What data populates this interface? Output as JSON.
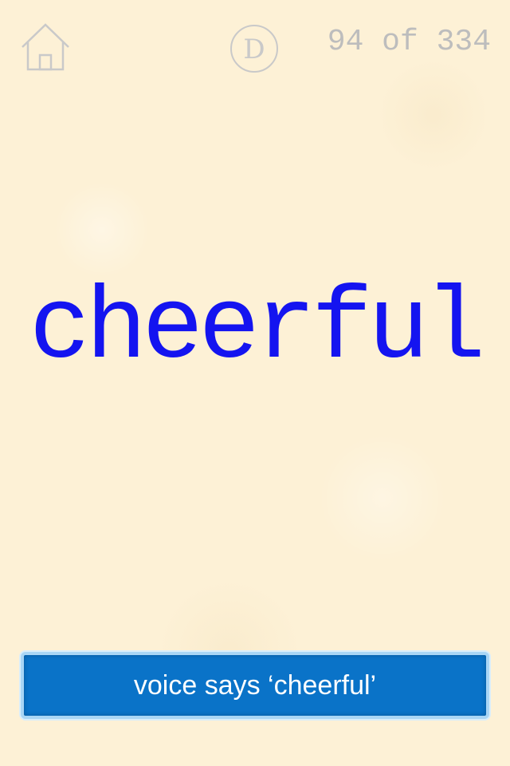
{
  "header": {
    "home_icon": "home-icon",
    "mode_letter": "D",
    "counter": "94 of 334"
  },
  "card": {
    "word": "cheerful"
  },
  "footer": {
    "voice_button_label": "voice says ‘cheerful’"
  },
  "colors": {
    "background": "#fdf1d6",
    "word": "#1414f0",
    "icons": "#c9c9c9",
    "counter": "#bdbdbd",
    "button": "#0a73c8",
    "button_border": "#a9d6f5"
  }
}
